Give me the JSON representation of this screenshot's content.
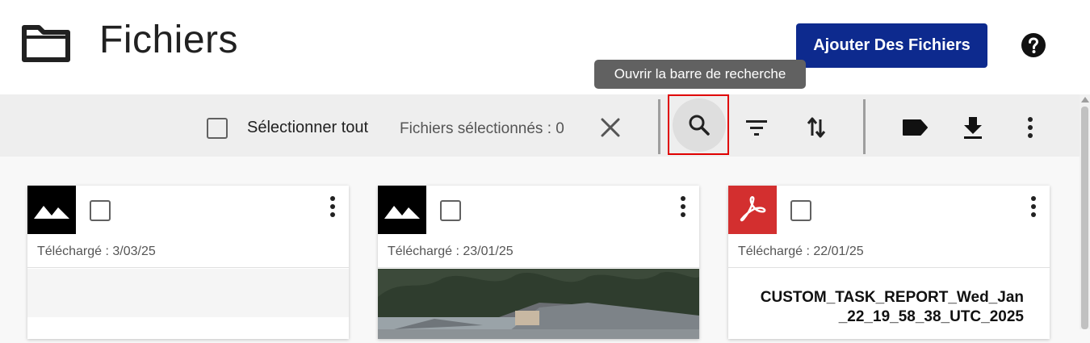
{
  "header": {
    "title": "Fichiers",
    "add_button": "Ajouter Des Fichiers",
    "icons": [
      "folder-icon",
      "help-icon"
    ]
  },
  "tooltip": {
    "text": "Ouvrir la barre de recherche"
  },
  "toolbar": {
    "select_all": "Sélectionner tout",
    "selected_count": "Fichiers sélectionnés : 0",
    "icons": [
      "close-icon",
      "search-icon",
      "filter-icon",
      "sort-icon",
      "label-icon",
      "download-icon",
      "more-vert-icon"
    ]
  },
  "files": [
    {
      "type": "image",
      "uploaded": "Téléchargé : 3/03/25"
    },
    {
      "type": "image",
      "uploaded": "Téléchargé : 23/01/25"
    },
    {
      "type": "pdf",
      "uploaded": "Téléchargé : 22/01/25",
      "name": "CUSTOM_TASK_REPORT_Wed_Jan _22_19_58_38_UTC_2025"
    }
  ],
  "colors": {
    "primary": "#0d2a8e",
    "pdf": "#d32f2f",
    "highlight": "#e00000",
    "tooltip": "#616161"
  }
}
